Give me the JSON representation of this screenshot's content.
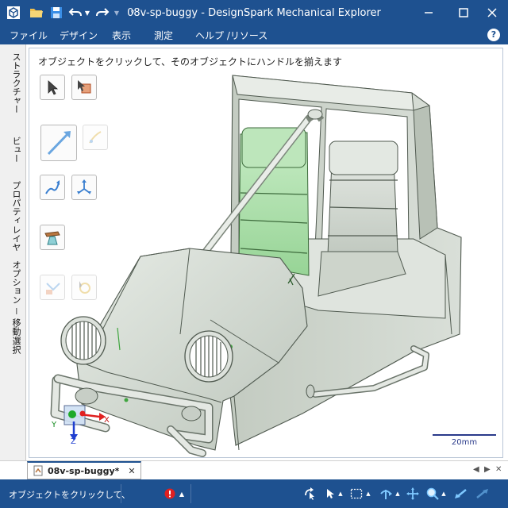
{
  "window": {
    "title": "08v-sp-buggy - DesignSpark Mechanical Explorer"
  },
  "menu": {
    "items": [
      "ファイル",
      "デザイン",
      "表示",
      "測定",
      "ヘルプ /リソース"
    ]
  },
  "left_tabs": [
    "ストラクチャー",
    "ビュー",
    "プロパティ",
    "レイヤ",
    "オプション － 移動",
    "選択"
  ],
  "viewport": {
    "hint": "オブジェクトをクリックして、そのオブジェクトにハンドルを揃えます",
    "scale_label": "20mm",
    "axis_labels": {
      "x": "X",
      "y": "Y",
      "z": "Z"
    }
  },
  "document_tab": {
    "label": "08v-sp-buggy*",
    "close": "✕"
  },
  "status": {
    "text": "オブジェクトをクリックして、"
  },
  "colors": {
    "chrome": "#1e5190",
    "model_body": "#d3dad2",
    "seat_selected": "#a9dca8"
  }
}
